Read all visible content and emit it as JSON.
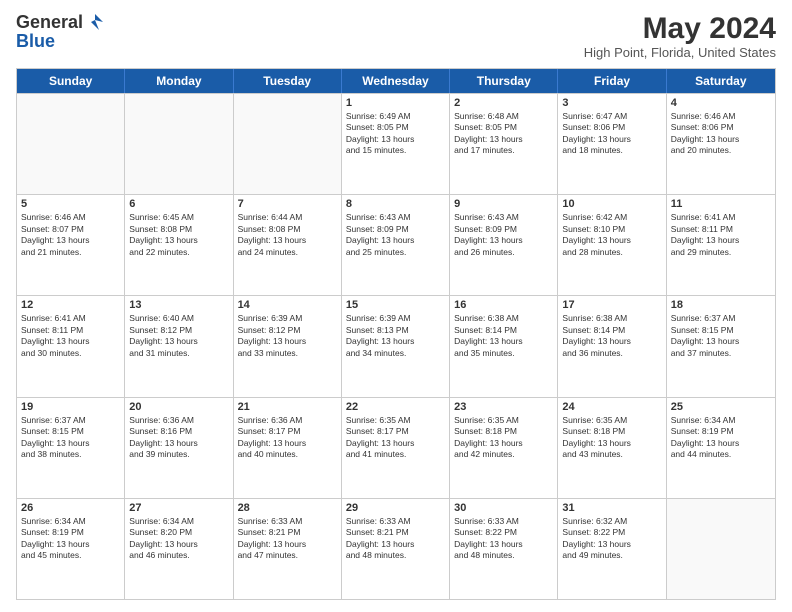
{
  "header": {
    "logo_general": "General",
    "logo_blue": "Blue",
    "month_year": "May 2024",
    "location": "High Point, Florida, United States"
  },
  "days_of_week": [
    "Sunday",
    "Monday",
    "Tuesday",
    "Wednesday",
    "Thursday",
    "Friday",
    "Saturday"
  ],
  "weeks": [
    [
      {
        "day": "",
        "info": ""
      },
      {
        "day": "",
        "info": ""
      },
      {
        "day": "",
        "info": ""
      },
      {
        "day": "1",
        "info": "Sunrise: 6:49 AM\nSunset: 8:05 PM\nDaylight: 13 hours\nand 15 minutes."
      },
      {
        "day": "2",
        "info": "Sunrise: 6:48 AM\nSunset: 8:05 PM\nDaylight: 13 hours\nand 17 minutes."
      },
      {
        "day": "3",
        "info": "Sunrise: 6:47 AM\nSunset: 8:06 PM\nDaylight: 13 hours\nand 18 minutes."
      },
      {
        "day": "4",
        "info": "Sunrise: 6:46 AM\nSunset: 8:06 PM\nDaylight: 13 hours\nand 20 minutes."
      }
    ],
    [
      {
        "day": "5",
        "info": "Sunrise: 6:46 AM\nSunset: 8:07 PM\nDaylight: 13 hours\nand 21 minutes."
      },
      {
        "day": "6",
        "info": "Sunrise: 6:45 AM\nSunset: 8:08 PM\nDaylight: 13 hours\nand 22 minutes."
      },
      {
        "day": "7",
        "info": "Sunrise: 6:44 AM\nSunset: 8:08 PM\nDaylight: 13 hours\nand 24 minutes."
      },
      {
        "day": "8",
        "info": "Sunrise: 6:43 AM\nSunset: 8:09 PM\nDaylight: 13 hours\nand 25 minutes."
      },
      {
        "day": "9",
        "info": "Sunrise: 6:43 AM\nSunset: 8:09 PM\nDaylight: 13 hours\nand 26 minutes."
      },
      {
        "day": "10",
        "info": "Sunrise: 6:42 AM\nSunset: 8:10 PM\nDaylight: 13 hours\nand 28 minutes."
      },
      {
        "day": "11",
        "info": "Sunrise: 6:41 AM\nSunset: 8:11 PM\nDaylight: 13 hours\nand 29 minutes."
      }
    ],
    [
      {
        "day": "12",
        "info": "Sunrise: 6:41 AM\nSunset: 8:11 PM\nDaylight: 13 hours\nand 30 minutes."
      },
      {
        "day": "13",
        "info": "Sunrise: 6:40 AM\nSunset: 8:12 PM\nDaylight: 13 hours\nand 31 minutes."
      },
      {
        "day": "14",
        "info": "Sunrise: 6:39 AM\nSunset: 8:12 PM\nDaylight: 13 hours\nand 33 minutes."
      },
      {
        "day": "15",
        "info": "Sunrise: 6:39 AM\nSunset: 8:13 PM\nDaylight: 13 hours\nand 34 minutes."
      },
      {
        "day": "16",
        "info": "Sunrise: 6:38 AM\nSunset: 8:14 PM\nDaylight: 13 hours\nand 35 minutes."
      },
      {
        "day": "17",
        "info": "Sunrise: 6:38 AM\nSunset: 8:14 PM\nDaylight: 13 hours\nand 36 minutes."
      },
      {
        "day": "18",
        "info": "Sunrise: 6:37 AM\nSunset: 8:15 PM\nDaylight: 13 hours\nand 37 minutes."
      }
    ],
    [
      {
        "day": "19",
        "info": "Sunrise: 6:37 AM\nSunset: 8:15 PM\nDaylight: 13 hours\nand 38 minutes."
      },
      {
        "day": "20",
        "info": "Sunrise: 6:36 AM\nSunset: 8:16 PM\nDaylight: 13 hours\nand 39 minutes."
      },
      {
        "day": "21",
        "info": "Sunrise: 6:36 AM\nSunset: 8:17 PM\nDaylight: 13 hours\nand 40 minutes."
      },
      {
        "day": "22",
        "info": "Sunrise: 6:35 AM\nSunset: 8:17 PM\nDaylight: 13 hours\nand 41 minutes."
      },
      {
        "day": "23",
        "info": "Sunrise: 6:35 AM\nSunset: 8:18 PM\nDaylight: 13 hours\nand 42 minutes."
      },
      {
        "day": "24",
        "info": "Sunrise: 6:35 AM\nSunset: 8:18 PM\nDaylight: 13 hours\nand 43 minutes."
      },
      {
        "day": "25",
        "info": "Sunrise: 6:34 AM\nSunset: 8:19 PM\nDaylight: 13 hours\nand 44 minutes."
      }
    ],
    [
      {
        "day": "26",
        "info": "Sunrise: 6:34 AM\nSunset: 8:19 PM\nDaylight: 13 hours\nand 45 minutes."
      },
      {
        "day": "27",
        "info": "Sunrise: 6:34 AM\nSunset: 8:20 PM\nDaylight: 13 hours\nand 46 minutes."
      },
      {
        "day": "28",
        "info": "Sunrise: 6:33 AM\nSunset: 8:21 PM\nDaylight: 13 hours\nand 47 minutes."
      },
      {
        "day": "29",
        "info": "Sunrise: 6:33 AM\nSunset: 8:21 PM\nDaylight: 13 hours\nand 48 minutes."
      },
      {
        "day": "30",
        "info": "Sunrise: 6:33 AM\nSunset: 8:22 PM\nDaylight: 13 hours\nand 48 minutes."
      },
      {
        "day": "31",
        "info": "Sunrise: 6:32 AM\nSunset: 8:22 PM\nDaylight: 13 hours\nand 49 minutes."
      },
      {
        "day": "",
        "info": ""
      }
    ]
  ]
}
